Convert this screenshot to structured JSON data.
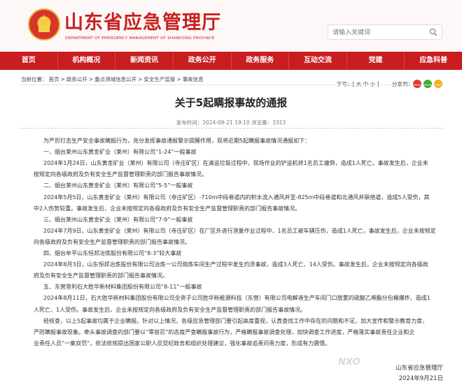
{
  "header": {
    "site_title": "山东省应急管理厅",
    "site_subtitle": "DEPARTMENT OF EMERGENCY MANAGEMENT OF SHANDONG PROVINCE",
    "search_placeholder": "请输入关键词"
  },
  "nav": {
    "items": [
      "首页",
      "机构概况",
      "新闻资讯",
      "政务公开",
      "政务服务",
      "互动交流",
      "党建",
      "应急科普"
    ]
  },
  "breadcrumb": {
    "label": "当前位置：",
    "items": [
      "首页",
      "政务公开",
      "重点领域信息公开",
      "安全生产监管",
      "事故信息"
    ],
    "sep": ">"
  },
  "tools": {
    "font_size_label": "字号：",
    "font_size_options": "[ 大 中 小 ]",
    "share_label": "分享到："
  },
  "article": {
    "title": "关于5起瞒报事故的通报",
    "meta": "发布时间：2024-09-21 19:10   浏览量：3313",
    "paragraphs": [
      {
        "text": "为严厉打击生产安全事故瞒报行为，充分发挥事故通报警示提醒作用，现将近期5起瞒报事故情况通报如下：",
        "indent": true
      },
      {
        "text": "一、烟台莱州山东黄金矿业（莱州）有限公司“1-24”一般事故",
        "indent": true
      },
      {
        "text": "2024年1月24日，山东黄金矿业（莱州）有限公司（寺庄矿区）在清运垃圾过程中，现场作业的铲运机将1名员工撞倒，造成1人死亡。事故发生后，企业未",
        "indent": true
      },
      {
        "text": "按规定向各级政府及负有安全生产监督管理职责的部门报告事故情况。",
        "indent": false
      },
      {
        "text": "二、烟台莱州山东黄金矿业（莱州）有限公司“5-5”一般事故",
        "indent": true
      },
      {
        "text": "2024年5月5日，山东黄金矿业（莱州）有限公司（寺庄矿区）-710m中段巷道内的积水流入通风井至-825m中段巷道和北通风井联络道，造成5人受伤，其",
        "indent": true
      },
      {
        "text": "中2人伤势较重。事故发生后，企业未按规定向各级政府及负有安全生产监督管理职责的部门报告事故情况。",
        "indent": false
      },
      {
        "text": "三、烟台莱州山东黄金矿业（莱州）有限公司“7-9”一般事故",
        "indent": true
      },
      {
        "text": "2024年7月9日，山东黄金矿业（莱州）有限公司（寺庄矿区）在厂区外进行测量作业过程中，1名员工被车辆压伤，造成1人死亡。事故发生后，企业未按规定",
        "indent": true
      },
      {
        "text": "向各级政府及负有安全生产监督管理职责的部门报告事故情况。",
        "indent": false
      },
      {
        "text": "四、烟台牟平山东恒邦冶炼股份有限公司“8-3”较大事故",
        "indent": true
      },
      {
        "text": "2024年8月3日，山东恒邦冶炼股份有限公司冶炼一公司熔炼车间生产过程中发生灼烫事故，造成3人死亡、14人受伤。事故发生后，企业未按规定向各级政",
        "indent": true
      },
      {
        "text": "府及负有安全生产监督管理职责的部门报告事故情况。",
        "indent": false
      },
      {
        "text": "五、东营垦利石大胜华新材料集团股份有限公司“8-11”一般事故",
        "indent": true
      },
      {
        "text": "2024年8月11日，石大胜华新材料集团股份有限公司全资子公司胜华新能源科技（东营）有限公司电解液生产车间门口放置的硫酸乙烯酯分包桶爆炸，造成1",
        "indent": true
      },
      {
        "text": "人死亡、1人受伤。事故发生后，企业未按规定向各级政府及负有安全生产监督管理职责的部门报告事故情况。",
        "indent": false
      },
      {
        "text": "经核查，以上5起事故均属于企业瞒报。针对以上情况，各级应急管理部门要引起高度重视，认真查找工作中存在的问题和不足，加大宣传和警示教育力度，",
        "indent": true
      },
      {
        "text": "严防瞒报事故现象。牵头事故调查的部门要以“零容忍”的态度严查瞒报事故行为，严格瞒报事故调查处理，加快调查工作进度，严格落实事故责任企业和企",
        "indent": false
      },
      {
        "text": "业责任人员“一案双罚”，依法依规提出国家公职人员党纪政务和组织处理建议，强化事故追责问责力度，形成有力震慑。",
        "indent": false
      }
    ],
    "signature": "山东省应急管理厅",
    "date": "2024年9月21日"
  },
  "watermark": "NXO"
}
